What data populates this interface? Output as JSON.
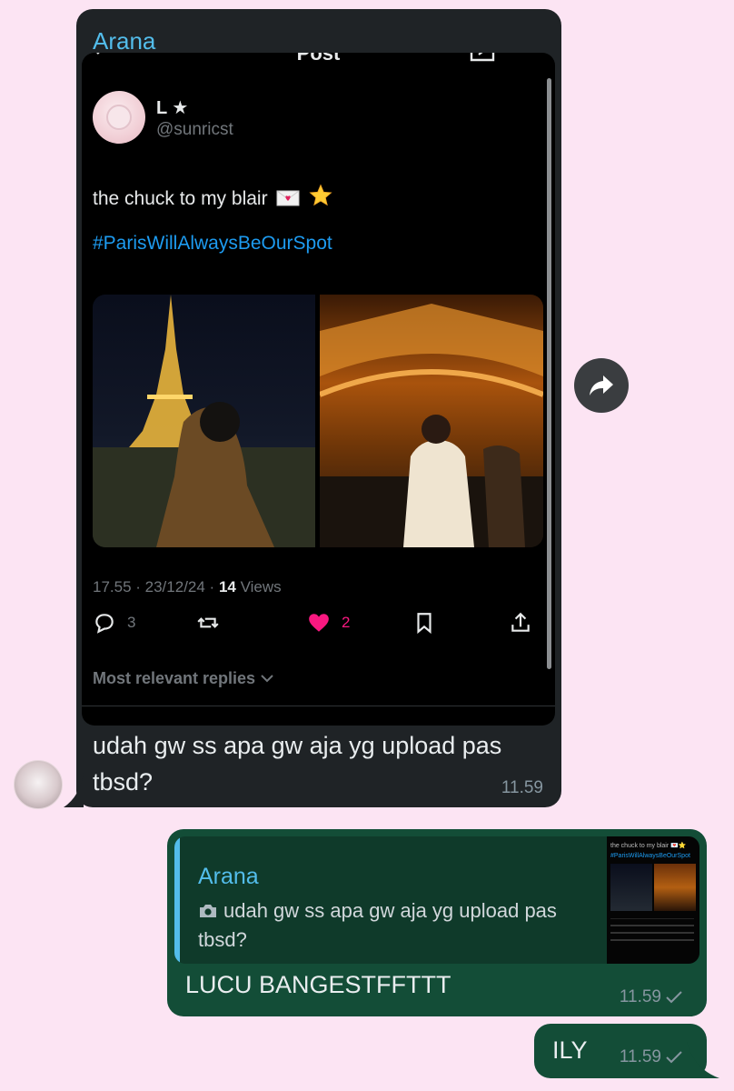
{
  "incoming": {
    "sender": "Arana",
    "screenshot": {
      "title": "Post",
      "author": {
        "name": "L ★",
        "handle": "@sunricst"
      },
      "text": "the chuck to my blair",
      "emojis": [
        "💌",
        "⭐"
      ],
      "hashtag": "#ParisWillAlwaysBeOurSpot",
      "meta": {
        "time_date": "17.55 · 23/12/24 · ",
        "views_count": "14",
        "views_label": " Views"
      },
      "actions": {
        "replies": "3",
        "likes": "2"
      },
      "sort_label": "Most relevant replies"
    },
    "message": "udah gw ss apa gw aja yg upload pas tbsd?",
    "time": "11.59"
  },
  "outgoing": [
    {
      "quote": {
        "sender": "Arana",
        "text": "udah gw ss apa gw aja yg upload pas tbsd?",
        "thumb_text": "the chuck to my blair 💌⭐",
        "thumb_hashtag": "#ParisWillAlwaysBeOurSpot"
      },
      "message": "LUCU BANGESTFFTTT",
      "time": "11.59"
    },
    {
      "message": "ILY",
      "time": "11.59"
    }
  ],
  "colors": {
    "background": "#fce4f3",
    "incoming_bubble": "#1f2326",
    "outgoing_bubble": "#134d37",
    "sender_name": "#53bdeb",
    "hashtag": "#1d9bf0",
    "like": "#f91880"
  }
}
